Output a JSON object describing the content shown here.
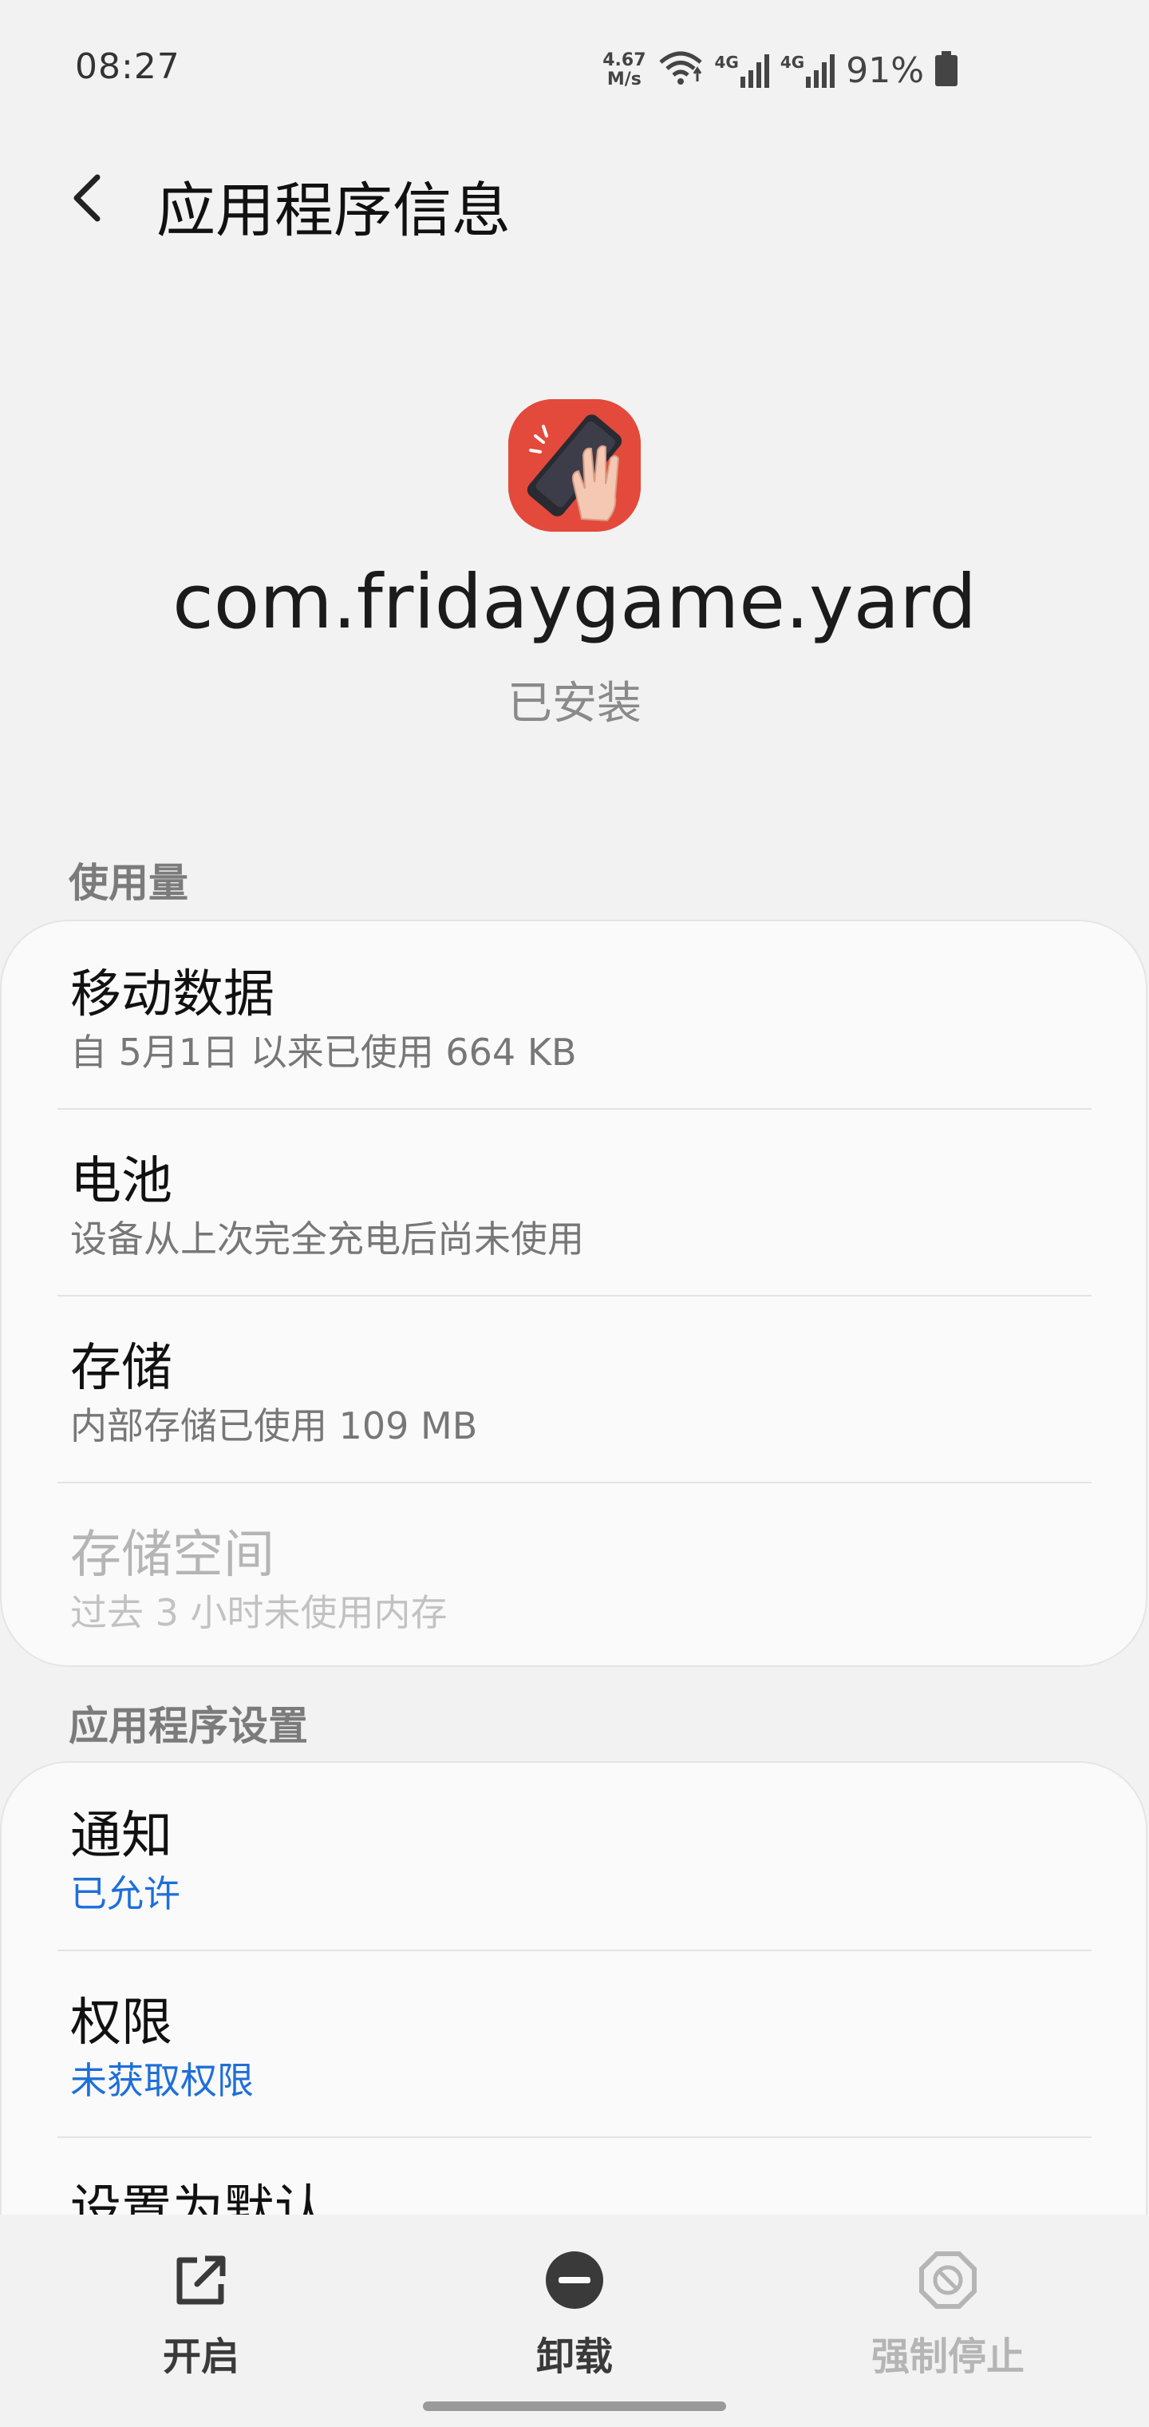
{
  "status_bar": {
    "time": "08:27",
    "net_speed_value": "4.67",
    "net_speed_unit": "M/s",
    "net1": "4G",
    "net2": "4G",
    "battery": "91%"
  },
  "header": {
    "title": "应用程序信息"
  },
  "app": {
    "name": "com.fridaygame.yard",
    "status": "已安装"
  },
  "usage": {
    "section_title": "使用量",
    "items": [
      {
        "title": "移动数据",
        "subtitle": "自 5月1日 以来已使用 664 KB"
      },
      {
        "title": "电池",
        "subtitle": "设备从上次完全充电后尚未使用"
      },
      {
        "title": "存储",
        "subtitle": "内部存储已使用 109 MB"
      },
      {
        "title": "存储空间",
        "subtitle": "过去 3 小时未使用内存"
      }
    ]
  },
  "app_settings": {
    "section_title": "应用程序设置",
    "items": [
      {
        "title": "通知",
        "subtitle": "已允许"
      },
      {
        "title": "权限",
        "subtitle": "未获取权限"
      },
      {
        "title": "设置为默认"
      }
    ]
  },
  "bottom_bar": {
    "open": "开启",
    "uninstall": "卸载",
    "force_stop": "强制停止"
  },
  "colors": {
    "accent_blue": "#1e6fd9",
    "app_icon_red": "#e34a3b"
  }
}
